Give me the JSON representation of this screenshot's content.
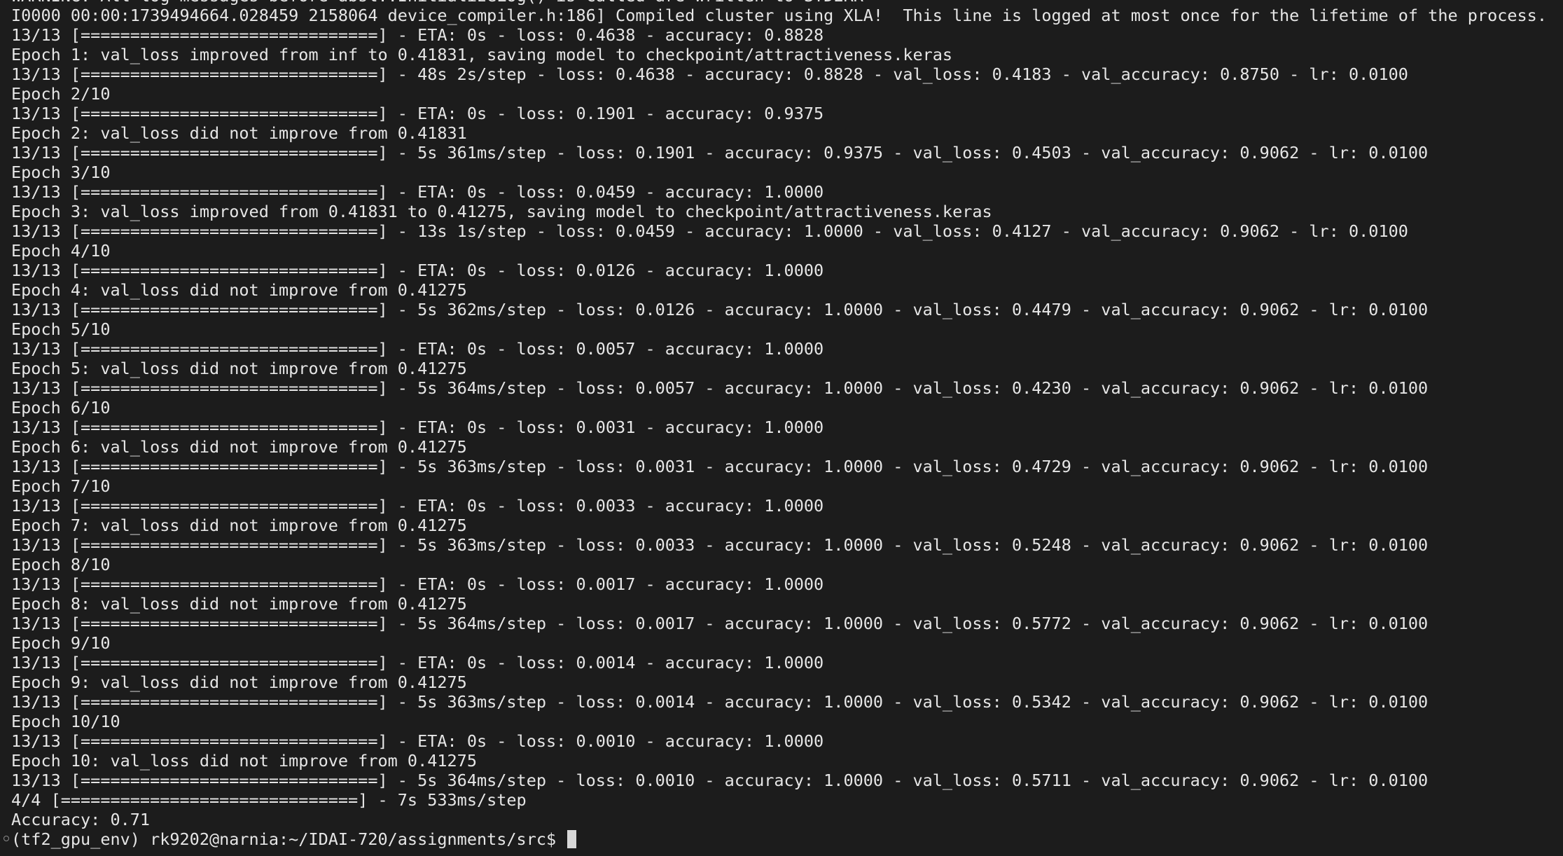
{
  "terminal": {
    "lines": [
      "WARNING: All log messages before absl::InitializeLog() is called are written to STDERR",
      "I0000 00:00:1739494664.028459 2158064 device_compiler.h:186] Compiled cluster using XLA!  This line is logged at most once for the lifetime of the process.",
      "13/13 [==============================] - ETA: 0s - loss: 0.4638 - accuracy: 0.8828",
      "Epoch 1: val_loss improved from inf to 0.41831, saving model to checkpoint/attractiveness.keras",
      "13/13 [==============================] - 48s 2s/step - loss: 0.4638 - accuracy: 0.8828 - val_loss: 0.4183 - val_accuracy: 0.8750 - lr: 0.0100",
      "Epoch 2/10",
      "13/13 [==============================] - ETA: 0s - loss: 0.1901 - accuracy: 0.9375",
      "Epoch 2: val_loss did not improve from 0.41831",
      "13/13 [==============================] - 5s 361ms/step - loss: 0.1901 - accuracy: 0.9375 - val_loss: 0.4503 - val_accuracy: 0.9062 - lr: 0.0100",
      "Epoch 3/10",
      "13/13 [==============================] - ETA: 0s - loss: 0.0459 - accuracy: 1.0000",
      "Epoch 3: val_loss improved from 0.41831 to 0.41275, saving model to checkpoint/attractiveness.keras",
      "13/13 [==============================] - 13s 1s/step - loss: 0.0459 - accuracy: 1.0000 - val_loss: 0.4127 - val_accuracy: 0.9062 - lr: 0.0100",
      "Epoch 4/10",
      "13/13 [==============================] - ETA: 0s - loss: 0.0126 - accuracy: 1.0000",
      "Epoch 4: val_loss did not improve from 0.41275",
      "13/13 [==============================] - 5s 362ms/step - loss: 0.0126 - accuracy: 1.0000 - val_loss: 0.4479 - val_accuracy: 0.9062 - lr: 0.0100",
      "Epoch 5/10",
      "13/13 [==============================] - ETA: 0s - loss: 0.0057 - accuracy: 1.0000",
      "Epoch 5: val_loss did not improve from 0.41275",
      "13/13 [==============================] - 5s 364ms/step - loss: 0.0057 - accuracy: 1.0000 - val_loss: 0.4230 - val_accuracy: 0.9062 - lr: 0.0100",
      "Epoch 6/10",
      "13/13 [==============================] - ETA: 0s - loss: 0.0031 - accuracy: 1.0000",
      "Epoch 6: val_loss did not improve from 0.41275",
      "13/13 [==============================] - 5s 363ms/step - loss: 0.0031 - accuracy: 1.0000 - val_loss: 0.4729 - val_accuracy: 0.9062 - lr: 0.0100",
      "Epoch 7/10",
      "13/13 [==============================] - ETA: 0s - loss: 0.0033 - accuracy: 1.0000",
      "Epoch 7: val_loss did not improve from 0.41275",
      "13/13 [==============================] - 5s 363ms/step - loss: 0.0033 - accuracy: 1.0000 - val_loss: 0.5248 - val_accuracy: 0.9062 - lr: 0.0100",
      "Epoch 8/10",
      "13/13 [==============================] - ETA: 0s - loss: 0.0017 - accuracy: 1.0000",
      "Epoch 8: val_loss did not improve from 0.41275",
      "13/13 [==============================] - 5s 364ms/step - loss: 0.0017 - accuracy: 1.0000 - val_loss: 0.5772 - val_accuracy: 0.9062 - lr: 0.0100",
      "Epoch 9/10",
      "13/13 [==============================] - ETA: 0s - loss: 0.0014 - accuracy: 1.0000",
      "Epoch 9: val_loss did not improve from 0.41275",
      "13/13 [==============================] - 5s 363ms/step - loss: 0.0014 - accuracy: 1.0000 - val_loss: 0.5342 - val_accuracy: 0.9062 - lr: 0.0100",
      "Epoch 10/10",
      "13/13 [==============================] - ETA: 0s - loss: 0.0010 - accuracy: 1.0000",
      "Epoch 10: val_loss did not improve from 0.41275",
      "13/13 [==============================] - 5s 364ms/step - loss: 0.0010 - accuracy: 1.0000 - val_loss: 0.5711 - val_accuracy: 0.9062 - lr: 0.0100",
      "4/4 [==============================] - 7s 533ms/step",
      "Accuracy: 0.71"
    ],
    "prompt": "(tf2_gpu_env) rk9202@narnia:~/IDAI-720/assignments/src$ ",
    "colors": {
      "background": "#1c1c1c",
      "foreground": "#e6e6e6",
      "cursor": "#d8d8d8"
    }
  }
}
